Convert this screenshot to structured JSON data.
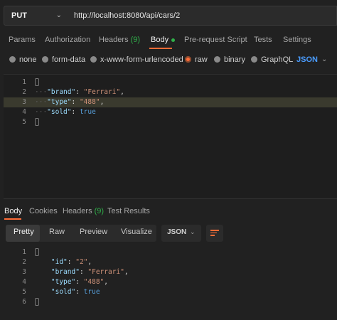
{
  "request": {
    "method": "PUT",
    "url": "http://localhost:8080/api/cars/2"
  },
  "request_tabs": [
    {
      "label": "Params"
    },
    {
      "label": "Authorization"
    },
    {
      "label": "Headers",
      "count": "(9)"
    },
    {
      "label": "Body",
      "active": true
    },
    {
      "label": "Pre-request Script"
    },
    {
      "label": "Tests"
    },
    {
      "label": "Settings"
    }
  ],
  "body_types": [
    {
      "label": "none"
    },
    {
      "label": "form-data"
    },
    {
      "label": "x-www-form-urlencoded"
    },
    {
      "label": "raw",
      "selected": true
    },
    {
      "label": "binary"
    },
    {
      "label": "GraphQL"
    }
  ],
  "body_format": "JSON",
  "request_body": {
    "line_numbers": [
      "1",
      "2",
      "3",
      "4",
      "5"
    ],
    "fields": [
      {
        "key": "\"brand\"",
        "value": "\"Ferrari\"",
        "sep": ","
      },
      {
        "key": "\"type\"",
        "value": "\"488\"",
        "sep": ","
      },
      {
        "key": "\"sold\"",
        "value": "true",
        "sep": ""
      }
    ]
  },
  "response_tabs": [
    {
      "label": "Body",
      "active": true
    },
    {
      "label": "Cookies"
    },
    {
      "label": "Headers",
      "count": "(9)"
    },
    {
      "label": "Test Results"
    }
  ],
  "response_views": [
    "Pretty",
    "Raw",
    "Preview",
    "Visualize"
  ],
  "response_format": "JSON",
  "response_body": {
    "line_numbers": [
      "1",
      "2",
      "3",
      "4",
      "5",
      "6"
    ],
    "fields": [
      {
        "key": "\"id\"",
        "value": "\"2\"",
        "sep": ","
      },
      {
        "key": "\"brand\"",
        "value": "\"Ferrari\"",
        "sep": ","
      },
      {
        "key": "\"type\"",
        "value": "\"488\"",
        "sep": ","
      },
      {
        "key": "\"sold\"",
        "value": "true",
        "sep": ""
      }
    ]
  },
  "colors": {
    "accent": "#ff6c37",
    "count_green": "#30b04a",
    "json_blue": "#4a9cff",
    "key": "#9cdcfe",
    "string": "#ce9178",
    "boolean": "#569cd6"
  },
  "icons": {
    "method_caret": "chevron-down-icon",
    "format_caret": "chevron-down-icon",
    "wrap": "wrap-lines-icon"
  }
}
